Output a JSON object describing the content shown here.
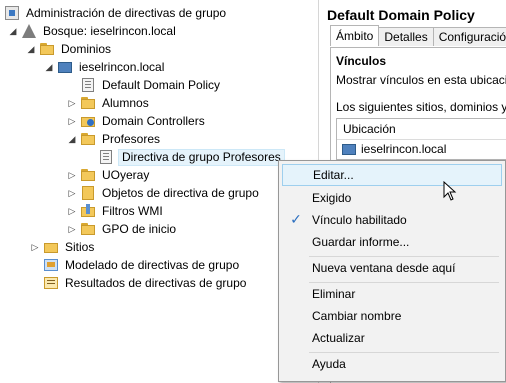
{
  "tree": {
    "items": [
      {
        "label": "Administración de directivas de grupo",
        "icon": "admin-icon",
        "expander": ""
      },
      {
        "label": "Bosque: ieselrincon.local",
        "icon": "forest-icon",
        "expander": "◢"
      },
      {
        "label": "Dominios",
        "icon": "folder-icon",
        "expander": "◢"
      },
      {
        "label": "ieselrincon.local",
        "icon": "domain-icon",
        "expander": "◢"
      },
      {
        "label": "Default Domain Policy",
        "icon": "gpo-link-icon",
        "expander": ""
      },
      {
        "label": "Alumnos",
        "icon": "folder-icon",
        "expander": "▷"
      },
      {
        "label": "Domain Controllers",
        "icon": "dc-folder-icon",
        "expander": "▷"
      },
      {
        "label": "Profesores",
        "icon": "folder-icon",
        "expander": "◢"
      },
      {
        "label": "Directiva de grupo Profesores",
        "icon": "gpo-link-icon",
        "expander": ""
      },
      {
        "label": "UOyeray",
        "icon": "folder-icon",
        "expander": "▷"
      },
      {
        "label": "Objetos de directiva de grupo",
        "icon": "gpo-folder-icon",
        "expander": "▷"
      },
      {
        "label": "Filtros WMI",
        "icon": "wmi-icon",
        "expander": "▷"
      },
      {
        "label": "GPO de inicio",
        "icon": "folder-icon",
        "expander": "▷"
      },
      {
        "label": "Sitios",
        "icon": "sites-icon",
        "expander": "▷"
      },
      {
        "label": "Modelado de directivas de grupo",
        "icon": "modeling-icon",
        "expander": ""
      },
      {
        "label": "Resultados de directivas de grupo",
        "icon": "results-icon",
        "expander": ""
      }
    ]
  },
  "right": {
    "title": "Default Domain Policy",
    "tabs": [
      "Ámbito",
      "Detalles",
      "Configuración"
    ],
    "section": "Vínculos",
    "show_links": "Mostrar vínculos en esta ubicación:",
    "following": "Los siguientes sitios, dominios y unid",
    "table_header": "Ubicación",
    "table_row": "ieselrincon.local"
  },
  "menu": {
    "items": [
      {
        "label": "Editar...",
        "checked": false
      },
      {
        "label": "Exigido",
        "checked": false
      },
      {
        "label": "Vínculo habilitado",
        "checked": true
      },
      {
        "label": "Guardar informe...",
        "checked": false
      },
      {
        "label": "Nueva ventana desde aquí",
        "checked": false
      },
      {
        "label": "Eliminar",
        "checked": false
      },
      {
        "label": "Cambiar nombre",
        "checked": false
      },
      {
        "label": "Actualizar",
        "checked": false
      },
      {
        "label": "Ayuda",
        "checked": false
      }
    ],
    "check_glyph": "✓"
  }
}
